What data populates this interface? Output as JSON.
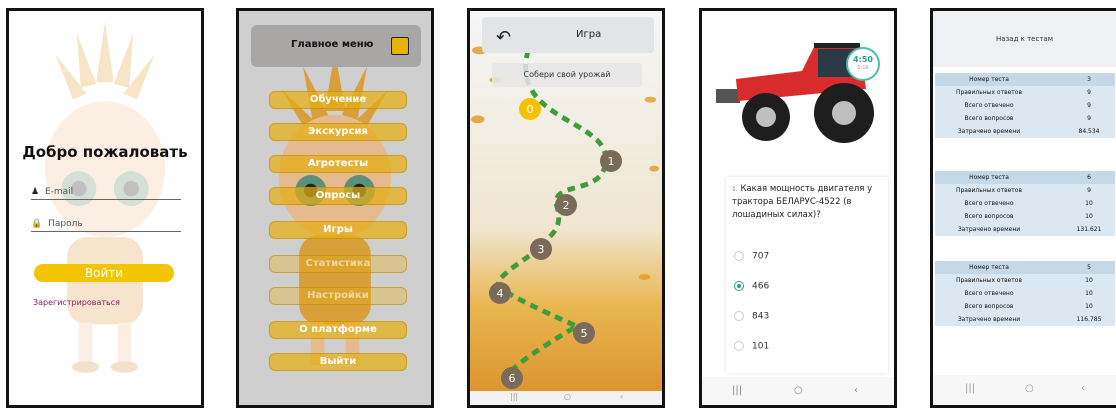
{
  "login": {
    "title": "Добро пожаловать",
    "email_placeholder": "E-mail",
    "password_placeholder": "Пароль",
    "login_button": "Войти",
    "register_link": "Зарегистрироваться"
  },
  "menu": {
    "title": "Главное меню",
    "items": [
      {
        "label": "Обучение"
      },
      {
        "label": "Экскурсия"
      },
      {
        "label": "Агротесты"
      },
      {
        "label": "Опросы"
      },
      {
        "label": "Игры"
      },
      {
        "label": "Статистика"
      },
      {
        "label": "Настройки"
      },
      {
        "label": "О платформе"
      },
      {
        "label": "Выйти"
      }
    ]
  },
  "game": {
    "title": "Игра",
    "subtitle": "Собери свой урожай",
    "levels": [
      "0",
      "1",
      "2",
      "3",
      "4",
      "5",
      "6"
    ]
  },
  "quiz": {
    "timer": "4:50",
    "timer_sub": "0:10",
    "question_number": "1.",
    "question": "Какая мощность двигателя у трактора БЕЛАРУС-4522 (в лошадиных силах)?",
    "options": [
      "707",
      "466",
      "843",
      "101"
    ],
    "selected": "466"
  },
  "results": {
    "back_button": "Назад к тестам",
    "tests": [
      {
        "rows": [
          {
            "k": "Номер теста",
            "v": "3"
          },
          {
            "k": "Правильных ответов",
            "v": "9"
          },
          {
            "k": "Всего отвечено",
            "v": "9"
          },
          {
            "k": "Всего вопросов",
            "v": "9"
          },
          {
            "k": "Затрачено времени",
            "v": "84.534"
          }
        ]
      },
      {
        "rows": [
          {
            "k": "Номер теста",
            "v": "6"
          },
          {
            "k": "Правильных ответов",
            "v": "9"
          },
          {
            "k": "Всего отвечено",
            "v": "10"
          },
          {
            "k": "Всего вопросов",
            "v": "10"
          },
          {
            "k": "Затрачено времени",
            "v": "131.621"
          }
        ]
      },
      {
        "rows": [
          {
            "k": "Номер теста",
            "v": "5"
          },
          {
            "k": "Правильных ответов",
            "v": "10"
          },
          {
            "k": "Всего отвечено",
            "v": "10"
          },
          {
            "k": "Всего вопросов",
            "v": "10"
          },
          {
            "k": "Затрачено времени",
            "v": "116.785"
          }
        ]
      }
    ]
  },
  "nav": {
    "recent": "|||",
    "home": "○",
    "back": "‹"
  }
}
